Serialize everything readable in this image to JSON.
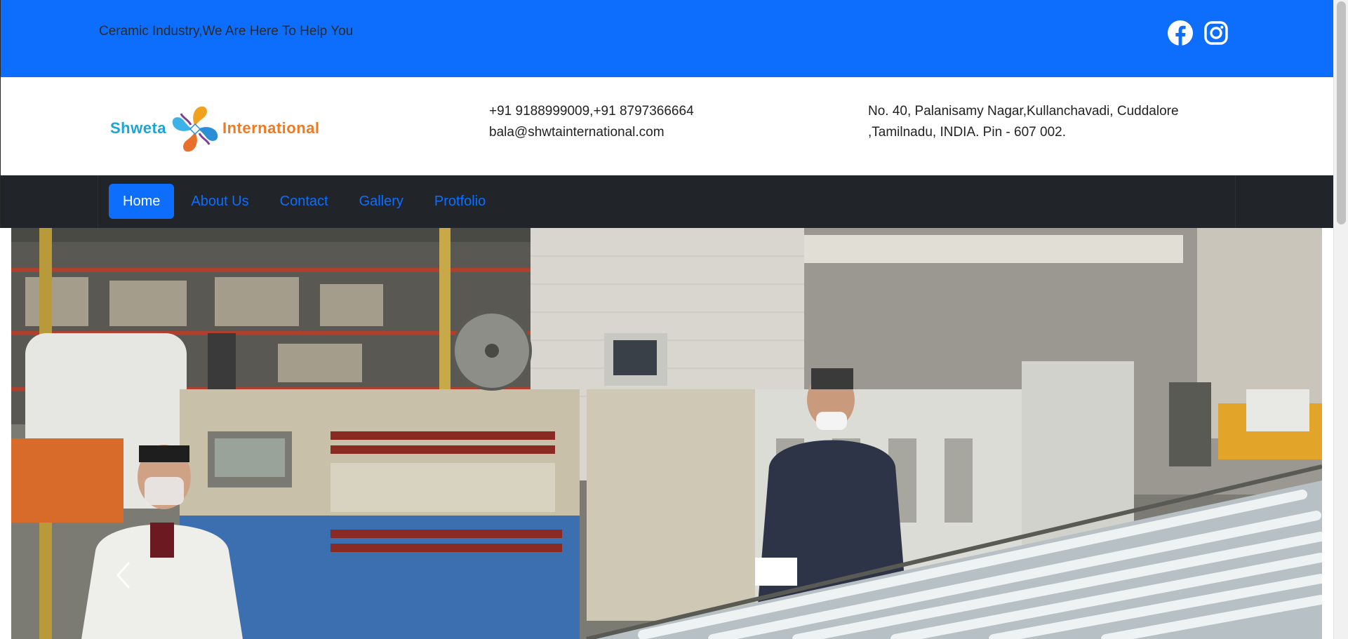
{
  "topbar": {
    "tagline": "Ceramic Industry,We Are Here To Help You",
    "social": [
      {
        "icon": "facebook-icon",
        "color": "#ffffff"
      },
      {
        "icon": "instagram-icon",
        "color": "#ffffff"
      }
    ],
    "background": "#0d6efd"
  },
  "header": {
    "logo": {
      "left_text": "Shweta",
      "right_text": "International"
    },
    "contact": {
      "phones": "+91 9188999009,+91 8797366664",
      "email": "bala@shwtainternational.com"
    },
    "address": {
      "line1": "No. 40, Palanisamy Nagar,Kullanchavadi, Cuddalore",
      "line2": ",Tamilnadu, INDIA. Pin - 607 002."
    }
  },
  "nav": {
    "items": [
      {
        "label": "Home",
        "active": true
      },
      {
        "label": "About Us",
        "active": false
      },
      {
        "label": "Contact",
        "active": false
      },
      {
        "label": "Gallery",
        "active": false
      },
      {
        "label": "Protfolio",
        "active": false
      }
    ],
    "accent": "#0d6efd",
    "background": "#212529"
  },
  "hero": {
    "controls": {
      "prev_icon": "chevron-left-icon"
    }
  }
}
